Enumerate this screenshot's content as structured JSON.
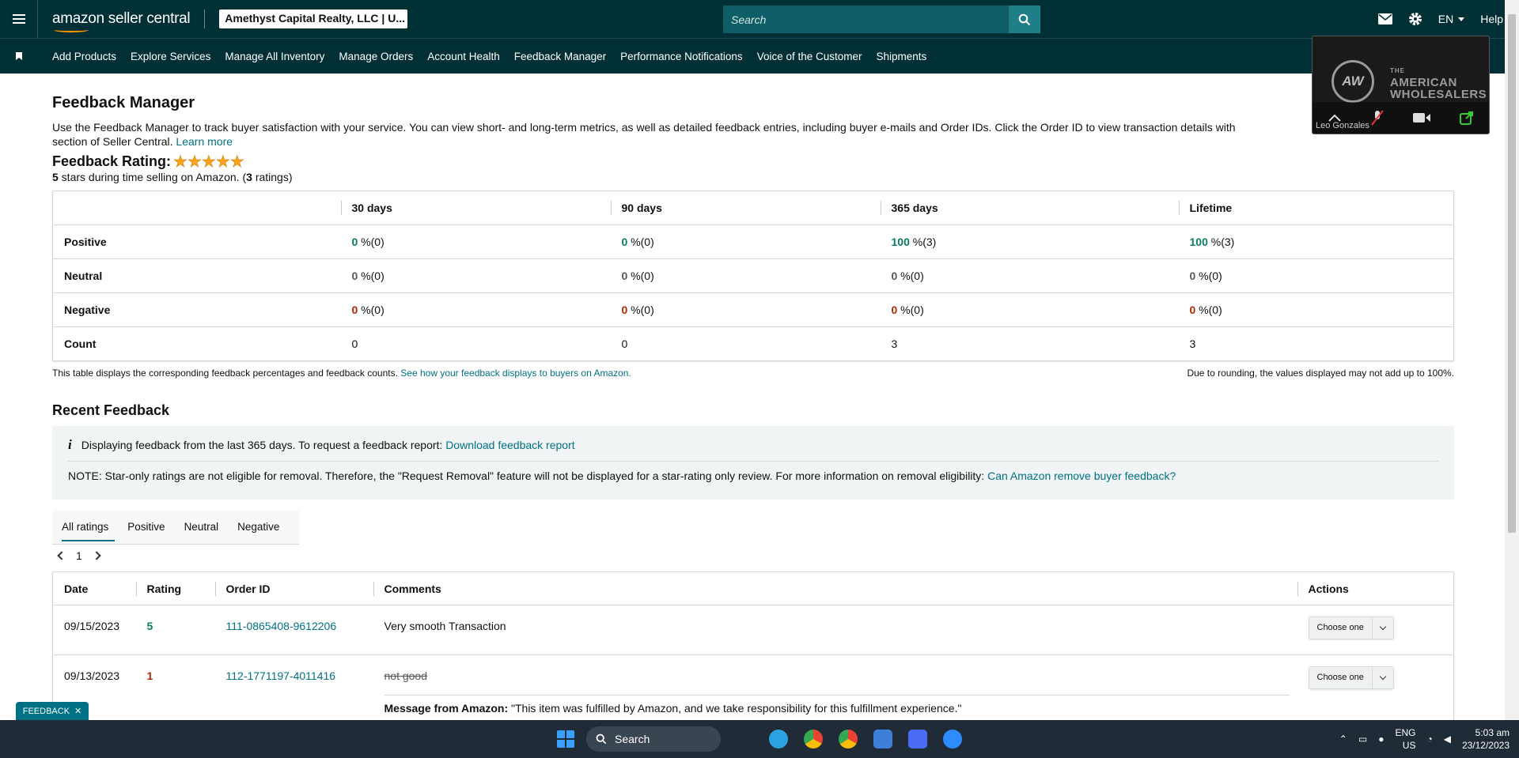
{
  "topbar": {
    "logo_text": "amazon seller central",
    "account": "Amethyst Capital Realty, LLC | U...",
    "search_placeholder": "Search",
    "language": "EN",
    "help": "Help"
  },
  "nav": {
    "items": [
      "Add Products",
      "Explore Services",
      "Manage All Inventory",
      "Manage Orders",
      "Account Health",
      "Feedback Manager",
      "Performance Notifications",
      "Voice of the Customer",
      "Shipments"
    ]
  },
  "video": {
    "logo": "AW",
    "title_line1": "THE",
    "title_line2": "AMERICAN",
    "title_line3": "WHOLESALERS",
    "participant": "Leo Gonzales"
  },
  "page": {
    "title": "Feedback Manager",
    "intro": "Use the Feedback Manager to track buyer satisfaction with your service. You can view short- and long-term metrics, as well as detailed feedback entries, including buyer e-mails and Order IDs. Click the Order ID to view transaction details with",
    "intro_line2": "section of Seller Central.",
    "learn_more": "Learn more",
    "rating_label": "Feedback Rating:",
    "stars": 5,
    "rating_stars_num": "5",
    "rating_text_a": " stars during time selling on Amazon. (",
    "rating_count": "3",
    "rating_text_b": " ratings)"
  },
  "summary": {
    "headers": [
      "",
      "30 days",
      "90 days",
      "365 days",
      "Lifetime"
    ],
    "rows": [
      {
        "label": "Positive",
        "kind": "pos",
        "cells": [
          {
            "num": "0",
            "rest": " %(0)"
          },
          {
            "num": "0",
            "rest": " %(0)"
          },
          {
            "num": "100",
            "rest": " %(3)"
          },
          {
            "num": "100",
            "rest": " %(3)"
          }
        ]
      },
      {
        "label": "Neutral",
        "kind": "neu",
        "cells": [
          {
            "num": "0",
            "rest": " %(0)"
          },
          {
            "num": "0",
            "rest": " %(0)"
          },
          {
            "num": "0",
            "rest": " %(0)"
          },
          {
            "num": "0",
            "rest": " %(0)"
          }
        ]
      },
      {
        "label": "Negative",
        "kind": "neg",
        "cells": [
          {
            "num": "0",
            "rest": " %(0)"
          },
          {
            "num": "0",
            "rest": " %(0)"
          },
          {
            "num": "0",
            "rest": " %(0)"
          },
          {
            "num": "0",
            "rest": " %(0)"
          }
        ]
      },
      {
        "label": "Count",
        "kind": "count",
        "cells": [
          {
            "num": "",
            "rest": "0"
          },
          {
            "num": "",
            "rest": "0"
          },
          {
            "num": "",
            "rest": "3"
          },
          {
            "num": "",
            "rest": "3"
          }
        ]
      }
    ],
    "note_left": "This table displays the corresponding feedback percentages and feedback counts.",
    "note_link": "See how your feedback displays to buyers on Amazon.",
    "note_right": "Due to rounding, the values displayed may not add up to 100%."
  },
  "recent": {
    "title": "Recent Feedback",
    "info_text": "Displaying feedback from the last 365 days. To request a feedback report:",
    "info_link": "Download feedback report",
    "note_text": "NOTE: Star-only ratings are not eligible for removal. Therefore, the \"Request Removal\" feature will not be displayed for a star-rating only review. For more information on removal eligibility:",
    "note_link": "Can Amazon remove buyer feedback?",
    "tabs": [
      "All ratings",
      "Positive",
      "Neutral",
      "Negative"
    ],
    "page": "1",
    "headers": [
      "Date",
      "Rating",
      "Order ID",
      "Comments",
      "Actions"
    ],
    "rows": [
      {
        "date": "09/15/2023",
        "rating": "5",
        "order": "111-0865408-9612206",
        "comment": "Very smooth Transaction",
        "action": "Choose one"
      },
      {
        "date": "09/13/2023",
        "rating": "1",
        "order": "112-1771197-4011416",
        "comment": "not good",
        "message_label": "Message from Amazon:",
        "message": " \"This item was fulfilled by Amazon, and we take responsibility for this fulfillment experience.\"",
        "action": "Choose one"
      }
    ]
  },
  "feedback_tab": "FEEDBACK",
  "taskbar": {
    "search": "Search",
    "lang_line1": "ENG",
    "lang_line2": "US",
    "time": "5:03 am",
    "date": "23/12/2023"
  }
}
